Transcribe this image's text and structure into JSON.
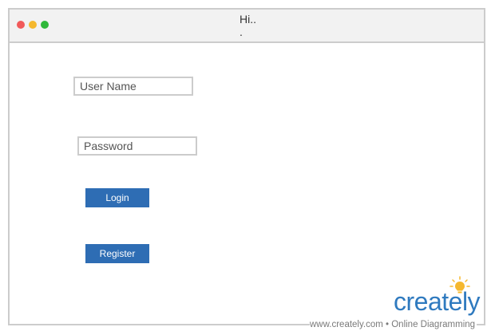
{
  "window": {
    "title": "Hi..\n."
  },
  "form": {
    "username_placeholder": "User Name",
    "password_placeholder": "Password",
    "login_label": "Login",
    "register_label": "Register"
  },
  "watermark": {
    "brand": "creately",
    "footer": "www.creately.com • Online Diagramming"
  },
  "colors": {
    "button": "#2e6db4",
    "brand": "#2f7abf",
    "bulb": "#f5b82e",
    "dot_red": "#f15a5a",
    "dot_yellow": "#f5b82e",
    "dot_green": "#2fb83a"
  },
  "icons": [
    "close-dot-icon",
    "minimize-dot-icon",
    "maximize-dot-icon",
    "lightbulb-icon"
  ]
}
